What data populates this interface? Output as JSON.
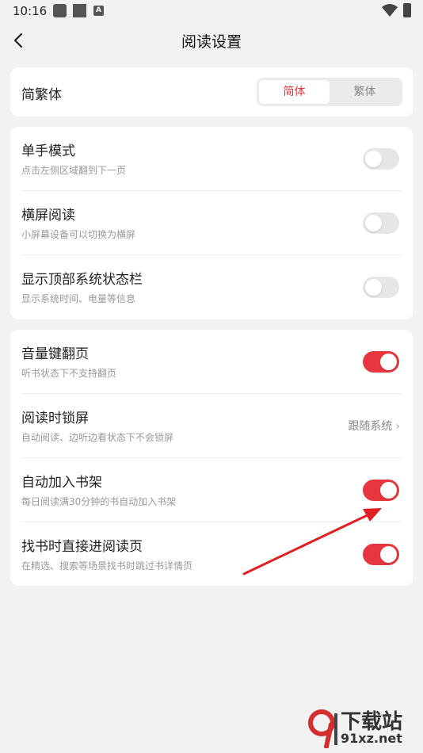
{
  "status_bar": {
    "time": "10:16",
    "icons": [
      "app-icon",
      "app-icon",
      "a-icon",
      "wifi-icon",
      "battery-charging-icon"
    ]
  },
  "header": {
    "title": "阅读设置",
    "back_icon": "chevron-left-icon"
  },
  "script_section": {
    "label": "简繁体",
    "options": [
      "简体",
      "繁体"
    ],
    "selected": "简体"
  },
  "display_section": {
    "items": [
      {
        "title": "单手模式",
        "subtitle": "点击左侧区域翻到下一页",
        "enabled": false
      },
      {
        "title": "横屏阅读",
        "subtitle": "小屏幕设备可以切换为横屏",
        "enabled": false
      },
      {
        "title": "显示顶部系统状态栏",
        "subtitle": "显示系统时间、电量等信息",
        "enabled": false
      }
    ]
  },
  "behavior_section": {
    "items": [
      {
        "title": "音量键翻页",
        "subtitle": "听书状态下不支持翻页",
        "enabled": true
      },
      {
        "title": "阅读时锁屏",
        "subtitle": "自动阅读、边听边看状态下不会锁屏",
        "value": "跟随系统"
      },
      {
        "title": "自动加入书架",
        "subtitle": "每日阅读满30分钟的书自动加入书架",
        "enabled": true
      },
      {
        "title": "找书时直接进阅读页",
        "subtitle": "在精选、搜索等场景找书时跳过书详情页",
        "enabled": true
      }
    ]
  },
  "colors": {
    "accent": "#e8363e",
    "toggle_off": "#e6e6e6",
    "background": "#f2f2f2",
    "annotation_arrow": "#e02020"
  },
  "watermark": {
    "text": "下载站",
    "domain": "91xz.net"
  }
}
